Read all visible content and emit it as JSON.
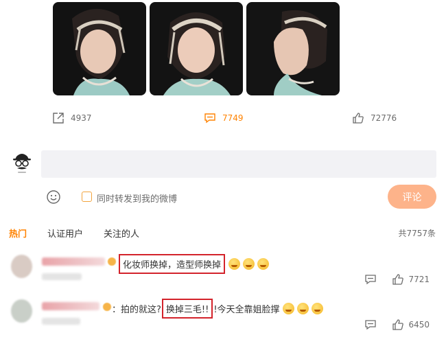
{
  "post": {
    "photos": [
      {
        "name": "photo-1"
      },
      {
        "name": "photo-2"
      },
      {
        "name": "photo-3"
      }
    ],
    "actions": {
      "repost_icon": "share-icon",
      "repost_count": "4937",
      "comment_icon": "comment-icon",
      "comment_count": "7749",
      "like_icon": "thumbs-up-icon",
      "like_count": "72776"
    }
  },
  "composer": {
    "avatar_icon": "incognito-avatar-icon",
    "emoji_icon": "smiley-icon",
    "forward_label": "同时转发到我的微博",
    "submit_label": "评论"
  },
  "tabs": [
    {
      "label": "热门",
      "active": true
    },
    {
      "label": "认证用户",
      "active": false
    },
    {
      "label": "关注的人",
      "active": false
    }
  ],
  "total_count": "共7757条",
  "comments": [
    {
      "highlighted_text": "化妆师换掉，造型师换掉",
      "prefix_text": "",
      "suffix_text": "",
      "emoji": [
        "laugh-cry-emoji",
        "laugh-cry-emoji",
        "laugh-cry-emoji"
      ],
      "like_count": "7721"
    },
    {
      "prefix_text": "：拍的就这?",
      "highlighted_text": "换掉三毛!!",
      "suffix_text": "!今天全靠姐脸撑",
      "emoji": [
        "grin-emoji",
        "smile-emoji",
        "smile-emoji"
      ],
      "like_count": "6450"
    }
  ],
  "colors": {
    "accent": "#ff8200",
    "submit_bg": "#fdb38a",
    "highlight_box": "#d3222a",
    "input_bg": "#f2f2f5"
  }
}
